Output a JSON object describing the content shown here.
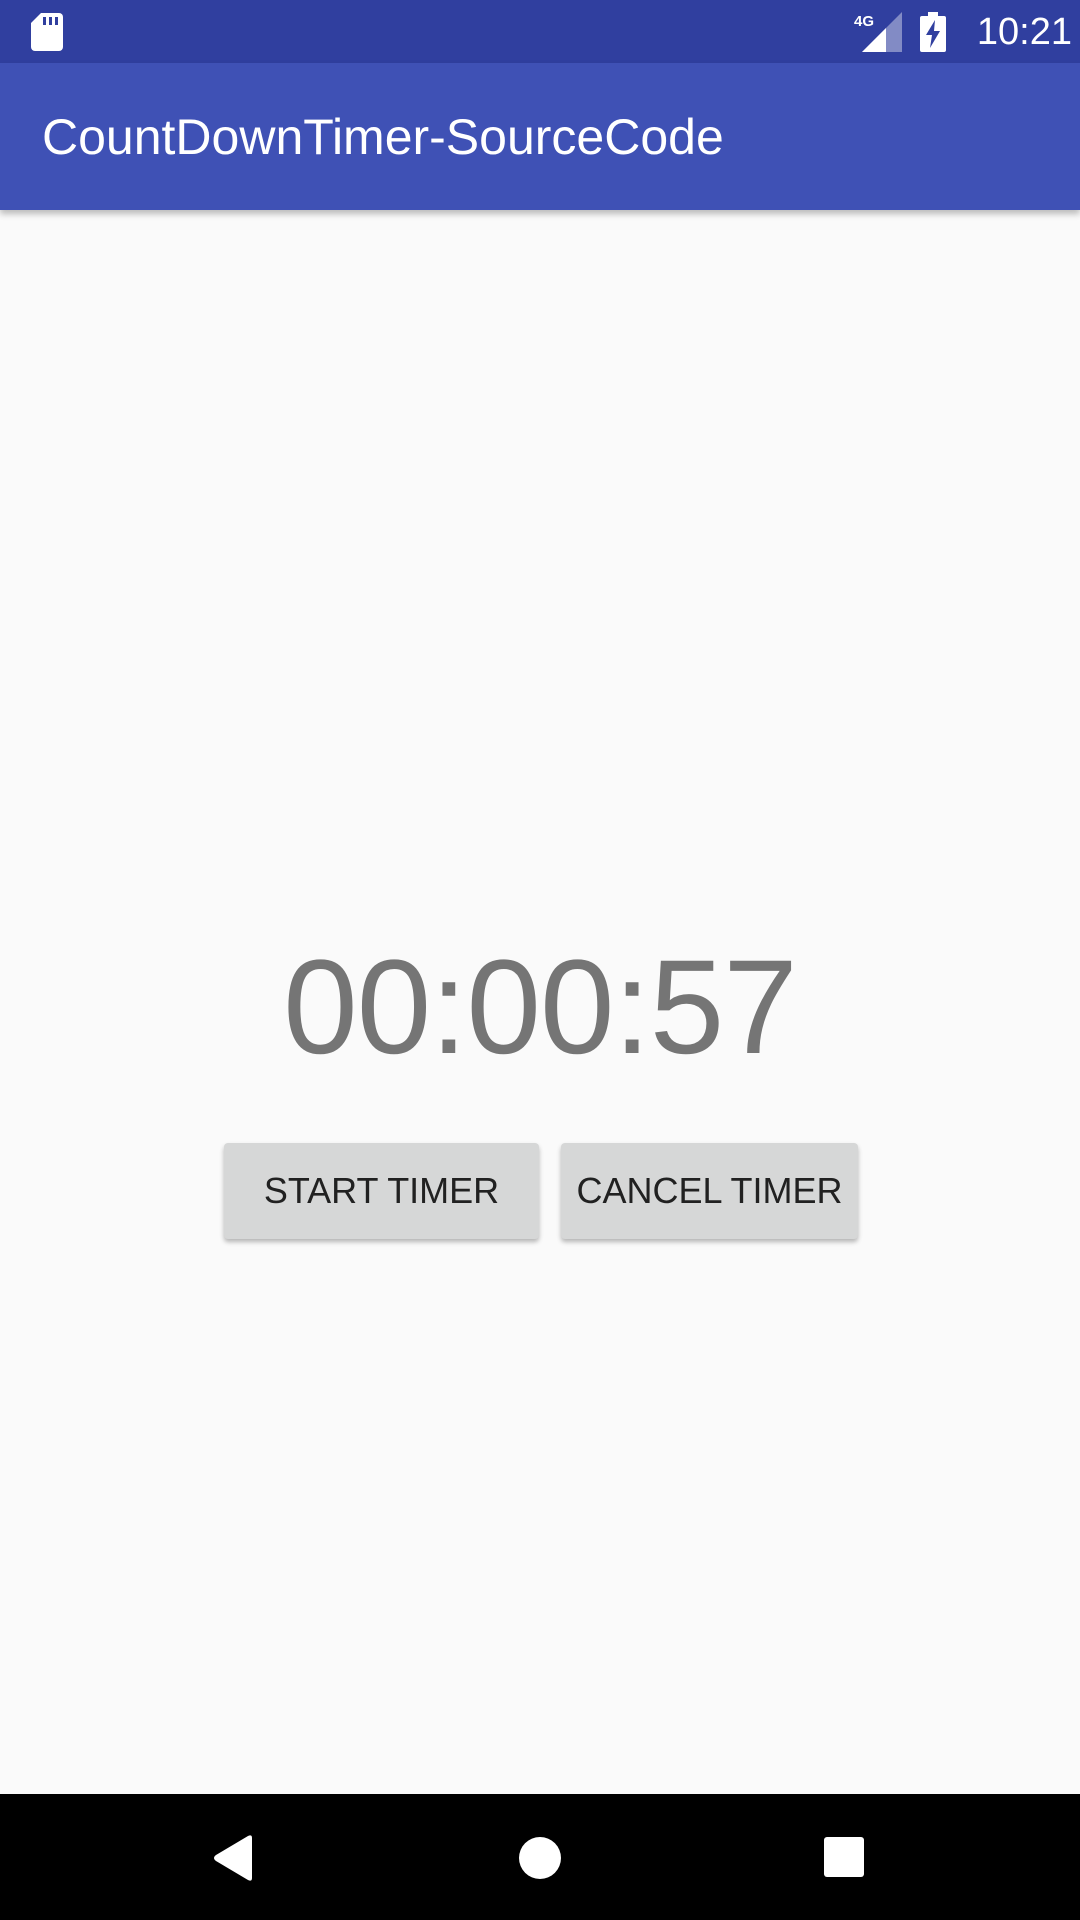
{
  "status_bar": {
    "network": "4G",
    "time": "10:21",
    "icons": [
      "sd-card-icon",
      "signal-icon",
      "battery-charging-icon"
    ]
  },
  "app_bar": {
    "title": "CountDownTimer-SourceCode"
  },
  "timer": {
    "display": "00:00:57"
  },
  "buttons": {
    "start_label": "START TIMER",
    "cancel_label": "CANCEL TIMER"
  },
  "nav_bar": {
    "icons": [
      "back-icon",
      "home-icon",
      "recents-icon"
    ]
  },
  "colors": {
    "status_bar": "#303f9f",
    "app_bar": "#3f51b5",
    "background": "#fafafa",
    "timer_text": "#757575",
    "button_bg": "#d6d7d7",
    "button_text": "#212121",
    "nav_bar": "#000000"
  }
}
